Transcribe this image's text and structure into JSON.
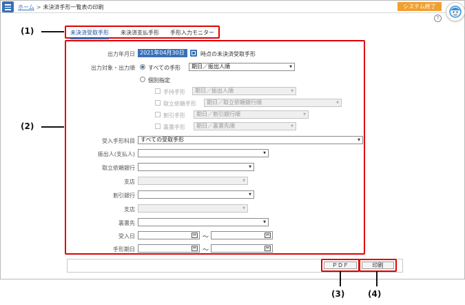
{
  "topbar": {
    "home": "ホーム",
    "separator": ">",
    "title": "未決済手形一覧表の印刷",
    "system_end": "システム終了",
    "help": "?"
  },
  "tabs": [
    {
      "label": "未決済受取手形",
      "active": true
    },
    {
      "label": "未決済支払手形",
      "active": false
    },
    {
      "label": "手形入力モニター",
      "active": false
    }
  ],
  "form": {
    "output_date_label": "出力年月日",
    "output_date_value": "2021年04月30日",
    "output_date_suffix": "時点の未決済受取手形",
    "target_order_label": "出力対象・出力順",
    "all_notes_label": "すべての手形",
    "all_notes_order": "期日／振出人順",
    "individual_label": "個別指定",
    "individual": [
      {
        "label": "手持手形",
        "value": "期日／振出人順"
      },
      {
        "label": "取立依頼手形",
        "value": "期日／取立依頼銀行順"
      },
      {
        "label": "割引手形",
        "value": "期日／割引銀行順"
      },
      {
        "label": "裏書手形",
        "value": "期日／裏書先順"
      }
    ],
    "account_label": "受入手形科目",
    "account_value": "すべての受取手形",
    "drawer_label": "振出人(支払人)",
    "collect_bank_label": "取立依頼銀行",
    "branch1_label": "支店",
    "discount_bank_label": "割引銀行",
    "branch2_label": "支店",
    "endorsee_label": "裏書先",
    "received_label": "受入日",
    "due_label": "手形期日",
    "tilde": "～"
  },
  "buttons": {
    "pdf": "ＰＤＦ",
    "print": "印刷"
  },
  "callouts": {
    "c1": "(1)",
    "c2": "(2)",
    "c3": "(3)",
    "c4": "(4)"
  },
  "colors": {
    "accent": "#3a6fb8",
    "highlight": "#e00000",
    "system_end": "#f0a030"
  }
}
